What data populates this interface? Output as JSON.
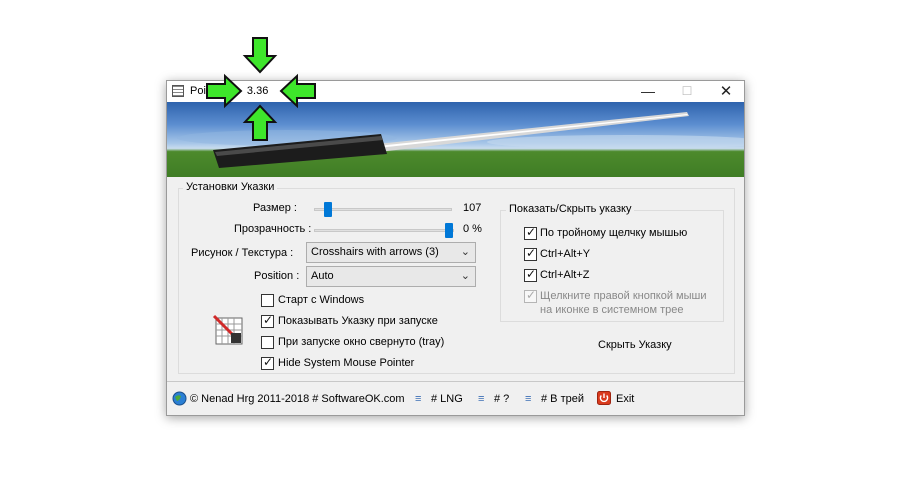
{
  "window": {
    "title": "Poi... 3.36",
    "title_prefix": "Poi",
    "title_version": "3.36",
    "controls": {
      "minimize": "—",
      "maximize": "☐",
      "close": "✕"
    }
  },
  "settings": {
    "legend": "Установки Указки",
    "size": {
      "label": "Размер :",
      "value": "107",
      "level_percent": 8
    },
    "transparency": {
      "label": "Прозрачность :",
      "value": "0 %",
      "level_percent": 100
    },
    "texture": {
      "label": "Рисунок / Текстура :",
      "selected": "Crosshairs with arrows (3)"
    },
    "position": {
      "label": "Position :",
      "selected": "Auto"
    },
    "checkboxes": [
      {
        "label": "Старт с Windows",
        "checked": false
      },
      {
        "label": "Показывать Указку при запуске",
        "checked": true
      },
      {
        "label": "При запуске окно свернуто (tray)",
        "checked": false
      },
      {
        "label": "Hide System Mouse Pointer",
        "checked": true
      }
    ]
  },
  "show_hide": {
    "legend": "Показать/Скрыть указку",
    "options": [
      {
        "label": "По тройному щелчку мышью",
        "checked": true
      },
      {
        "label": "Ctrl+Alt+Y",
        "checked": true
      },
      {
        "label": "Ctrl+Alt+Z",
        "checked": true
      },
      {
        "label_line1": "Щелкните правой кнопкой мыши",
        "label_line2": "на иконке в системном трее",
        "checked": true,
        "disabled": true
      }
    ],
    "hide_button": "Скрыть Указку"
  },
  "footer": {
    "copyright": "© Nenad Hrg 2011-2018 # SoftwareOK.com",
    "lng": "# LNG",
    "help": "# ?",
    "tray": "# В трей",
    "exit": "Exit"
  },
  "colors": {
    "accent": "#0078d7",
    "arrow_green": "#3ee62b",
    "exit_red": "#d93a1c"
  }
}
